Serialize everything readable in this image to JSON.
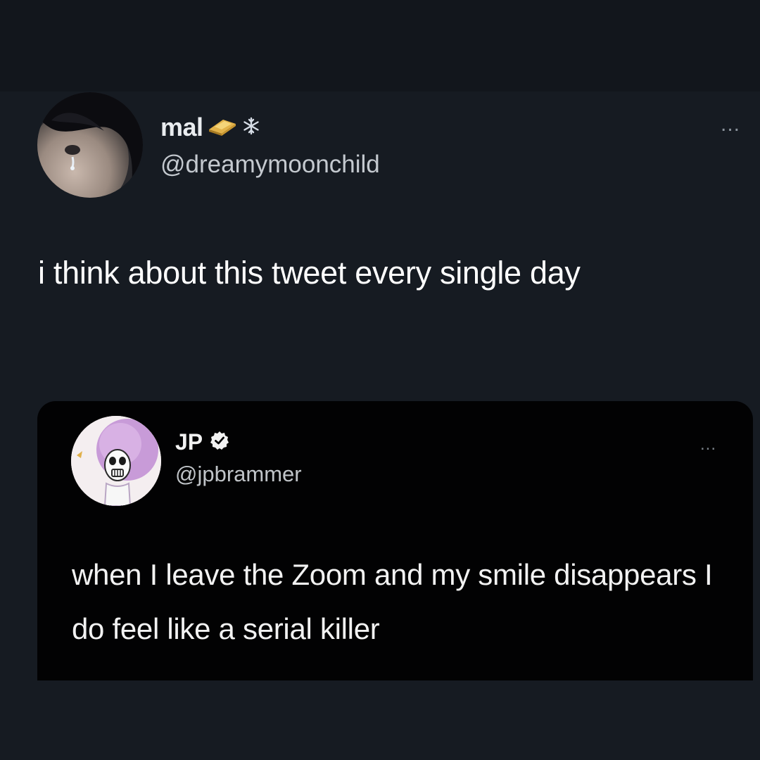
{
  "outer_tweet": {
    "display_name": "mal",
    "name_emojis": [
      "gold-bar-icon",
      "snowflake-icon"
    ],
    "handle": "@dreamymoonchild",
    "more_label": "...",
    "text": "i think about this tweet every single day"
  },
  "quoted_tweet": {
    "display_name": "JP",
    "verified": true,
    "handle": "@jpbrammer",
    "more_label": "...",
    "text": "when I leave the Zoom and my smile disappears I do feel like a serial killer"
  },
  "colors": {
    "background": "#161b22",
    "card_background": "#020203",
    "text": "#ffffff",
    "muted_text": "#c4c9cf"
  }
}
